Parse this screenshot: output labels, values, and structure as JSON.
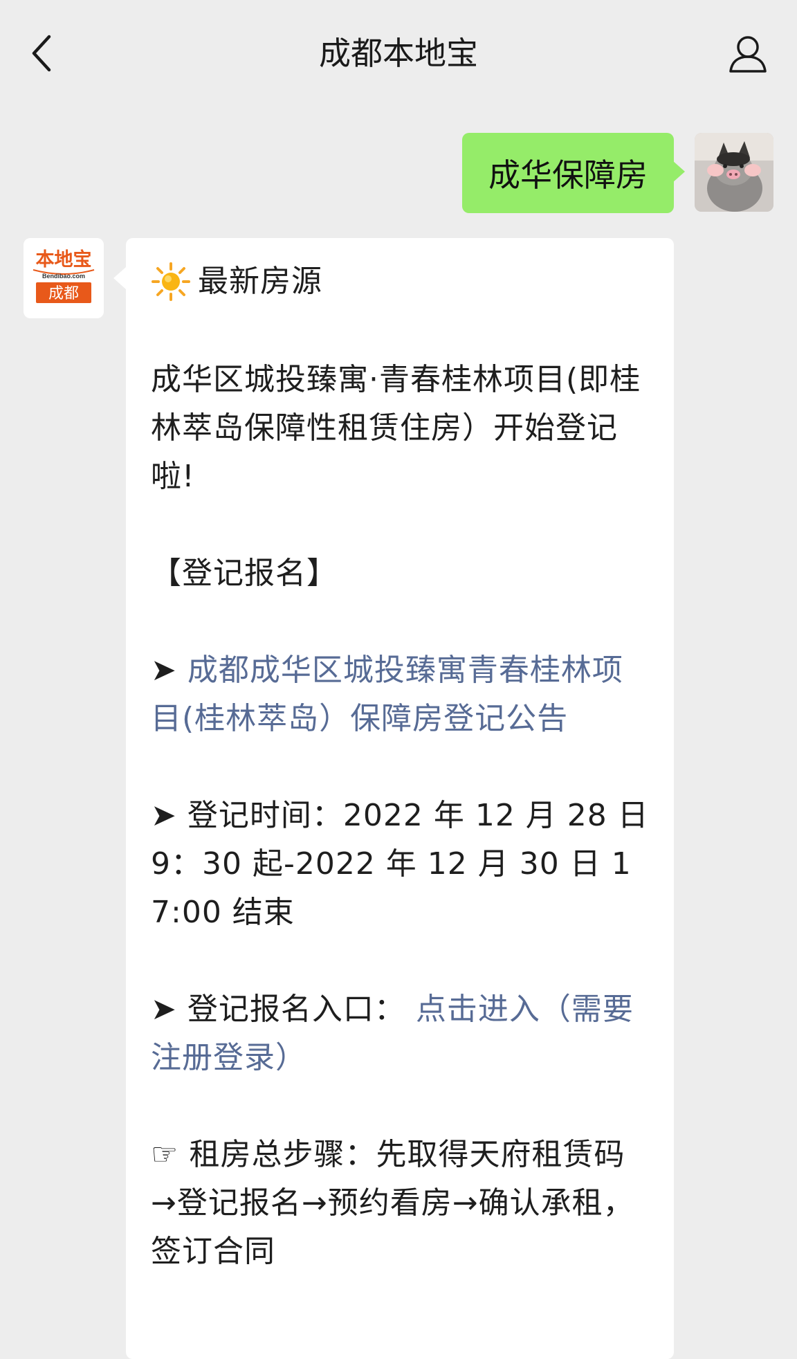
{
  "header": {
    "title": "成都本地宝"
  },
  "sent_message": {
    "text": "成华保障房"
  },
  "bot": {
    "logo_top": "本地宝",
    "logo_small": "Bendibao.com",
    "logo_city": "成都"
  },
  "reply": {
    "heading": "最新房源",
    "intro": "成华区城投臻寓·青春桂林项目(即桂林萃岛保障性租赁住房）开始登记啦!",
    "section_title": "【登记报名】",
    "bullet_symbol": "➤",
    "announcement_link": "成都成华区城投臻寓青春桂林项目(桂林萃岛）保障房登记公告",
    "time_text": "登记时间：2022 年 12 月 28 日 9：30 起-2022 年 12 月 30 日 17:00 结束",
    "entry_label": "登记报名入口：",
    "entry_link": "点击进入（需要注册登录）",
    "steps_symbol": "☞",
    "steps_text": "租房总步骤：先取得天府租赁码→登记报名→预约看房→确认承租，签订合同"
  },
  "colors": {
    "background": "#ededed",
    "sent_bubble": "#95ec69",
    "link": "#576b95"
  },
  "icons": {
    "back": "chevron-left-icon",
    "profile": "user-icon",
    "sun": "sun-icon"
  }
}
